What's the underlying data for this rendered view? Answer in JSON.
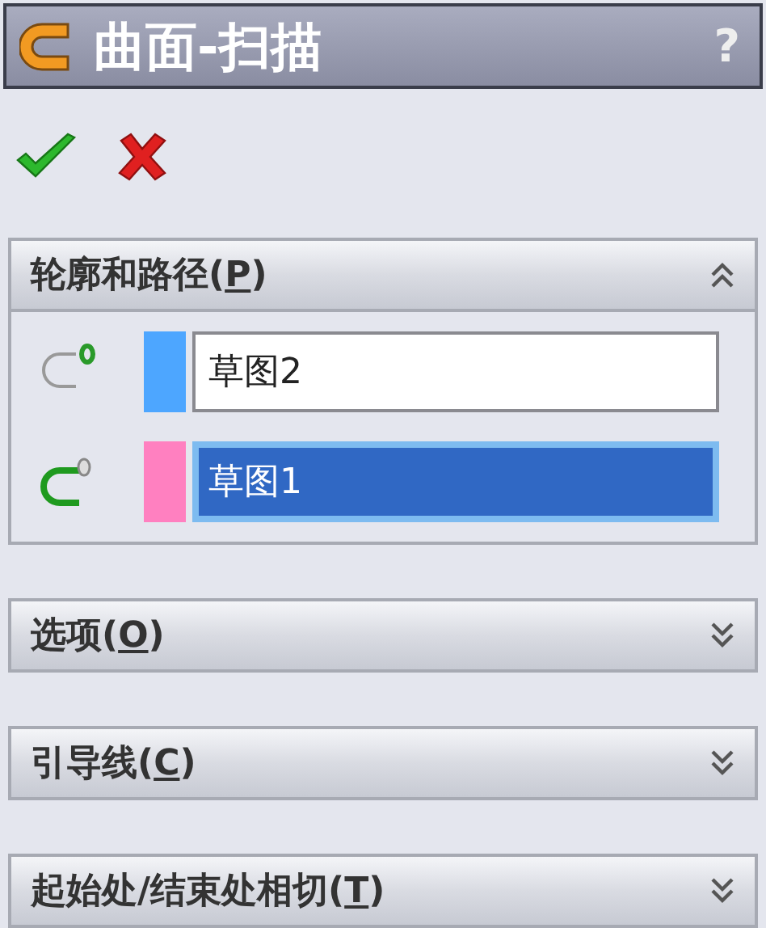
{
  "window": {
    "title": "曲面-扫描",
    "help": "?"
  },
  "sections": [
    {
      "title_parts": [
        "轮廓和路径(",
        "P",
        ")"
      ],
      "expanded": true,
      "fields": [
        {
          "kind": "profile",
          "color": "#4da6ff",
          "value": "草图2",
          "selected": false
        },
        {
          "kind": "path",
          "color": "#ff80c0",
          "value": "草图1",
          "selected": true
        }
      ]
    },
    {
      "title_parts": [
        "选项(",
        "O",
        ")"
      ],
      "expanded": false
    },
    {
      "title_parts": [
        "引导线(",
        "C",
        ")"
      ],
      "expanded": false
    },
    {
      "title_parts": [
        "起始处/结束处相切(",
        "T",
        ")"
      ],
      "expanded": false
    }
  ]
}
